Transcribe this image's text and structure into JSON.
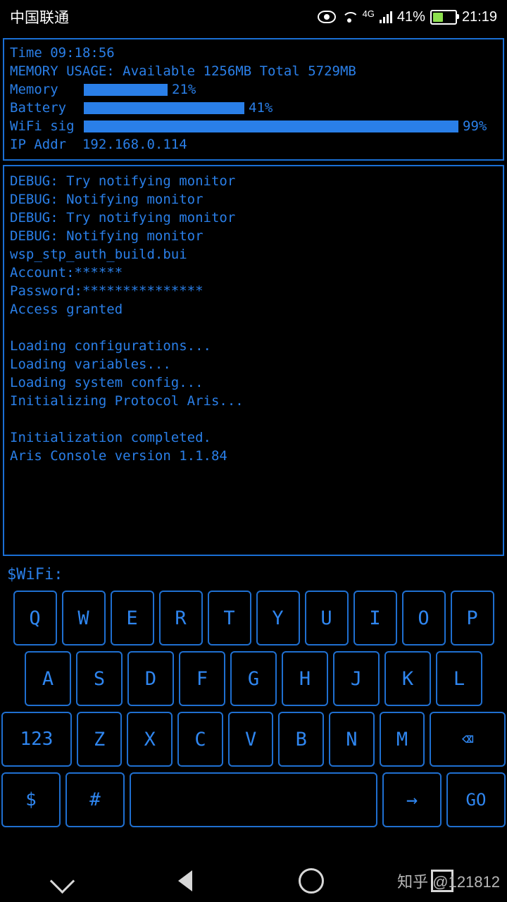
{
  "statusbar": {
    "carrier": "中国联通",
    "network_type": "4G",
    "battery_percent": "41%",
    "clock": "21:19",
    "icons": [
      "eye-icon",
      "wifi-icon",
      "signal-bars-icon",
      "battery-icon"
    ]
  },
  "info_panel": {
    "time_line": "Time 09:18:56",
    "memory_line": "MEMORY USAGE: Available 1256MB Total 5729MB",
    "gauges": [
      {
        "label": "Memory",
        "value": "21%",
        "percent": 21
      },
      {
        "label": "Battery",
        "value": "41%",
        "percent": 41
      },
      {
        "label": "WiFi sig",
        "value": "99%",
        "percent": 99
      }
    ],
    "ip_line": "IP Addr  192.168.0.114"
  },
  "console": {
    "lines": [
      "DEBUG: Try notifying monitor",
      "DEBUG: Notifying monitor",
      "DEBUG: Try notifying monitor",
      "DEBUG: Notifying monitor",
      "wsp_stp_auth_build.bui",
      "Account:******",
      "Password:***************",
      "Access granted",
      "",
      "Loading configurations...",
      "Loading variables...",
      "Loading system config...",
      "Initializing Protocol Aris...",
      "",
      "Initialization completed.",
      "Aris Console version 1.1.84"
    ]
  },
  "prompt": {
    "text": "$WiFi:"
  },
  "keyboard": {
    "row1": [
      "Q",
      "W",
      "E",
      "R",
      "T",
      "Y",
      "U",
      "I",
      "O",
      "P"
    ],
    "row2": [
      "A",
      "S",
      "D",
      "F",
      "G",
      "H",
      "J",
      "K",
      "L"
    ],
    "row3_left": "123",
    "row3": [
      "Z",
      "X",
      "C",
      "V",
      "B",
      "N",
      "M"
    ],
    "row3_delete": "⌫",
    "row4": {
      "dollar": "$",
      "hash": "#",
      "space": "",
      "enter": "→",
      "go": "GO"
    }
  },
  "navbar": {
    "items": [
      "chevron-down-icon",
      "back-triangle-icon",
      "home-circle-icon",
      "recents-square-icon"
    ],
    "watermark": "知乎 @121812"
  },
  "colors": {
    "accent": "#2a7fe8",
    "border": "#1a6fd4",
    "key_text": "#2f86f0",
    "background": "#000000"
  }
}
